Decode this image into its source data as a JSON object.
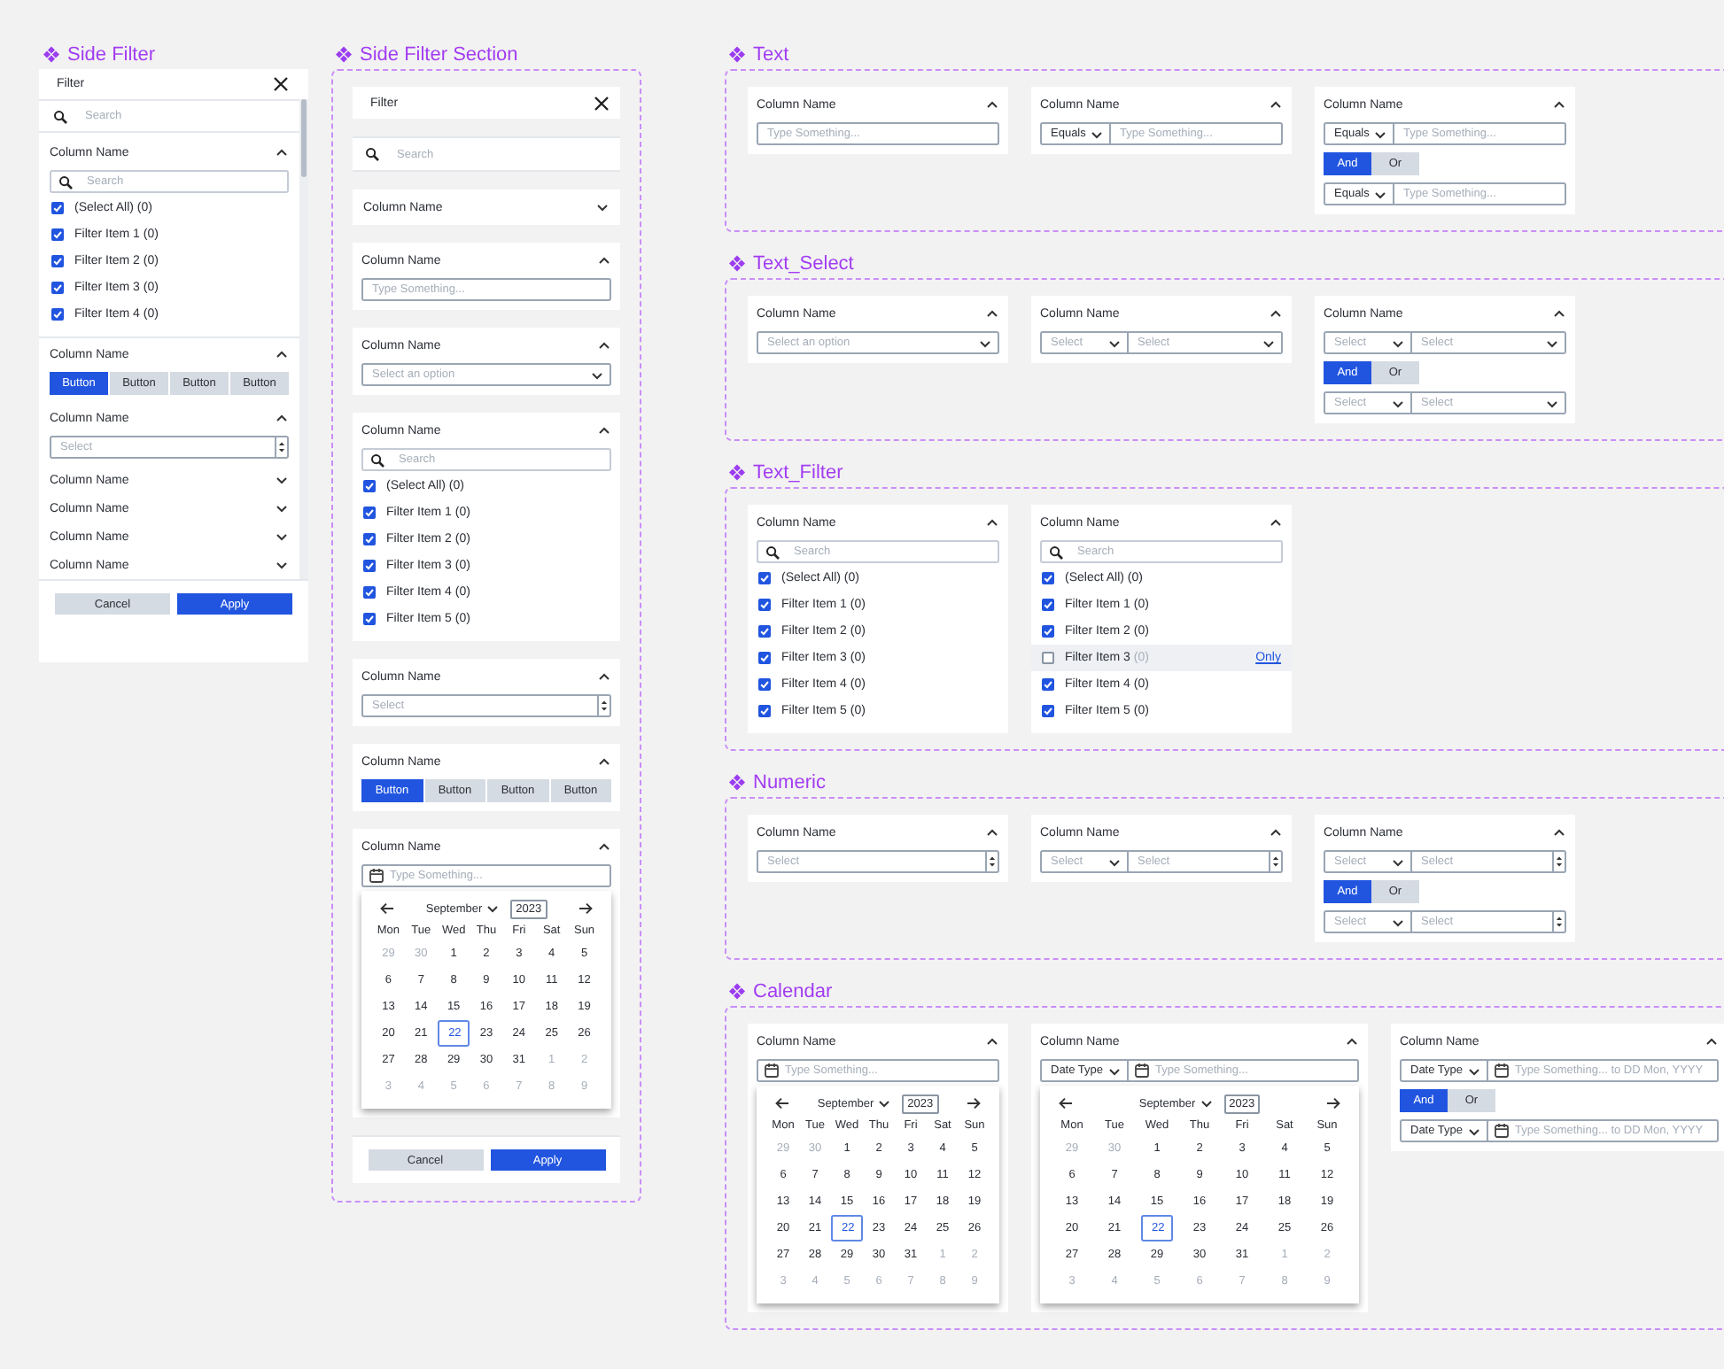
{
  "side_filter": {
    "title": "Side Filter",
    "header": "Filter",
    "search": {
      "placeholder": "Search"
    },
    "cards": [
      {
        "label": "Column Name",
        "expanded": true,
        "rows": [
          {
            "kind": "search",
            "placeholder": "Search"
          },
          {
            "kind": "checklist",
            "items": [
              {
                "label": "(Select All)",
                "count": "(0)",
                "checked": true,
                "hovered": false
              },
              {
                "label": "Filter Item 1",
                "count": "(0)",
                "checked": true,
                "hovered": false
              },
              {
                "label": "Filter Item 2",
                "count": "(0)",
                "checked": true,
                "hovered": false
              },
              {
                "label": "Filter Item 3",
                "count": "(0)",
                "checked": true,
                "hovered": false
              },
              {
                "label": "Filter Item 4",
                "count": "(0)",
                "checked": true,
                "hovered": false
              }
            ]
          }
        ]
      },
      {
        "label": "Column Name",
        "expanded": true,
        "rows": [
          {
            "kind": "segmented",
            "buttons": [
              {
                "label": "Button",
                "selected": true
              },
              {
                "label": "Button",
                "selected": false
              },
              {
                "label": "Button",
                "selected": false
              },
              {
                "label": "Button",
                "selected": false
              }
            ]
          }
        ]
      },
      {
        "label": "Column Name",
        "expanded": true,
        "rows": [
          {
            "kind": "number",
            "placeholder": "Select"
          }
        ]
      },
      {
        "label": "Column Name",
        "expanded": false
      },
      {
        "label": "Column Name",
        "expanded": false
      },
      {
        "label": "Column Name",
        "expanded": false
      },
      {
        "label": "Column Name",
        "expanded": false
      }
    ],
    "buttons": [
      {
        "label": "Cancel",
        "kind": "secondary"
      },
      {
        "label": "Apply",
        "kind": "primary"
      }
    ]
  },
  "side_filter_section": {
    "title": "Side Filter Section",
    "header": "Filter",
    "search": {
      "placeholder": "Search"
    },
    "cards": [
      {
        "label": "Column Name",
        "expanded": false
      },
      {
        "label": "Column Name",
        "expanded": true,
        "rows": [
          {
            "kind": "text",
            "placeholder": "Type Something..."
          }
        ]
      },
      {
        "label": "Column Name",
        "expanded": true,
        "rows": [
          {
            "kind": "select",
            "placeholder": "Select an option"
          }
        ]
      },
      {
        "label": "Column Name",
        "expanded": true,
        "rows": [
          {
            "kind": "search",
            "placeholder": "Search"
          },
          {
            "kind": "checklist",
            "items": [
              {
                "label": "(Select All)",
                "count": "(0)",
                "checked": true,
                "hovered": false
              },
              {
                "label": "Filter Item 1",
                "count": "(0)",
                "checked": true,
                "hovered": false
              },
              {
                "label": "Filter Item 2",
                "count": "(0)",
                "checked": true,
                "hovered": false
              },
              {
                "label": "Filter Item 3",
                "count": "(0)",
                "checked": true,
                "hovered": false
              },
              {
                "label": "Filter Item 4",
                "count": "(0)",
                "checked": true,
                "hovered": false
              },
              {
                "label": "Filter Item 5",
                "count": "(0)",
                "checked": true,
                "hovered": false
              }
            ]
          }
        ]
      },
      {
        "label": "Column Name",
        "expanded": true,
        "rows": [
          {
            "kind": "number",
            "placeholder": "Select"
          }
        ]
      },
      {
        "label": "Column Name",
        "expanded": true,
        "rows": [
          {
            "kind": "segmented",
            "buttons": [
              {
                "label": "Button",
                "selected": true
              },
              {
                "label": "Button",
                "selected": false
              },
              {
                "label": "Button",
                "selected": false
              },
              {
                "label": "Button",
                "selected": false
              }
            ]
          }
        ]
      },
      {
        "label": "Column Name",
        "expanded": true,
        "rows": [
          {
            "kind": "date",
            "placeholder": "Type Something..."
          },
          {
            "kind": "calendar",
            "month": "September",
            "year": "2023",
            "weekdays": [
              "Mon",
              "Tue",
              "Wed",
              "Thu",
              "Fri",
              "Sat",
              "Sun"
            ],
            "weeks": [
              [
                {
                  "label": "29",
                  "muted": true,
                  "selected": false
                },
                {
                  "label": "30",
                  "muted": true,
                  "selected": false
                },
                {
                  "label": "1",
                  "muted": false,
                  "selected": false
                },
                {
                  "label": "2",
                  "muted": false,
                  "selected": false
                },
                {
                  "label": "3",
                  "muted": false,
                  "selected": false
                },
                {
                  "label": "4",
                  "muted": false,
                  "selected": false
                },
                {
                  "label": "5",
                  "muted": false,
                  "selected": false
                }
              ],
              [
                {
                  "label": "6",
                  "muted": false,
                  "selected": false
                },
                {
                  "label": "7",
                  "muted": false,
                  "selected": false
                },
                {
                  "label": "8",
                  "muted": false,
                  "selected": false
                },
                {
                  "label": "9",
                  "muted": false,
                  "selected": false
                },
                {
                  "label": "10",
                  "muted": false,
                  "selected": false
                },
                {
                  "label": "11",
                  "muted": false,
                  "selected": false
                },
                {
                  "label": "12",
                  "muted": false,
                  "selected": false
                }
              ],
              [
                {
                  "label": "13",
                  "muted": false,
                  "selected": false
                },
                {
                  "label": "14",
                  "muted": false,
                  "selected": false
                },
                {
                  "label": "15",
                  "muted": false,
                  "selected": false
                },
                {
                  "label": "16",
                  "muted": false,
                  "selected": false
                },
                {
                  "label": "17",
                  "muted": false,
                  "selected": false
                },
                {
                  "label": "18",
                  "muted": false,
                  "selected": false
                },
                {
                  "label": "19",
                  "muted": false,
                  "selected": false
                }
              ],
              [
                {
                  "label": "20",
                  "muted": false,
                  "selected": false
                },
                {
                  "label": "21",
                  "muted": false,
                  "selected": false
                },
                {
                  "label": "22",
                  "muted": false,
                  "selected": true
                },
                {
                  "label": "23",
                  "muted": false,
                  "selected": false
                },
                {
                  "label": "24",
                  "muted": false,
                  "selected": false
                },
                {
                  "label": "25",
                  "muted": false,
                  "selected": false
                },
                {
                  "label": "26",
                  "muted": false,
                  "selected": false
                }
              ],
              [
                {
                  "label": "27",
                  "muted": false,
                  "selected": false
                },
                {
                  "label": "28",
                  "muted": false,
                  "selected": false
                },
                {
                  "label": "29",
                  "muted": false,
                  "selected": false
                },
                {
                  "label": "30",
                  "muted": false,
                  "selected": false
                },
                {
                  "label": "31",
                  "muted": false,
                  "selected": false
                },
                {
                  "label": "1",
                  "muted": true,
                  "selected": false
                },
                {
                  "label": "2",
                  "muted": true,
                  "selected": false
                }
              ],
              [
                {
                  "label": "3",
                  "muted": true,
                  "selected": false
                },
                {
                  "label": "4",
                  "muted": true,
                  "selected": false
                },
                {
                  "label": "5",
                  "muted": true,
                  "selected": false
                },
                {
                  "label": "6",
                  "muted": true,
                  "selected": false
                },
                {
                  "label": "7",
                  "muted": true,
                  "selected": false
                },
                {
                  "label": "8",
                  "muted": true,
                  "selected": false
                },
                {
                  "label": "9",
                  "muted": true,
                  "selected": false
                }
              ]
            ]
          }
        ]
      }
    ],
    "buttons": [
      {
        "label": "Cancel",
        "kind": "secondary"
      },
      {
        "label": "Apply",
        "kind": "primary"
      }
    ]
  },
  "sections": [
    {
      "title": "Text",
      "cards": [
        {
          "label": "Column Name",
          "expanded": true,
          "rows": [
            {
              "kind": "text",
              "placeholder": "Type Something..."
            }
          ]
        },
        {
          "label": "Column Name",
          "expanded": true,
          "rows": [
            {
              "kind": "op_text",
              "operator": "Equals",
              "placeholder": "Type Something..."
            }
          ]
        },
        {
          "label": "Column Name",
          "expanded": true,
          "rows": [
            {
              "kind": "op_text",
              "operator": "Equals",
              "placeholder": "Type Something..."
            },
            {
              "kind": "logic",
              "options": [
                {
                  "label": "And",
                  "selected": true
                },
                {
                  "label": "Or",
                  "selected": false
                }
              ]
            },
            {
              "kind": "op_text",
              "operator": "Equals",
              "placeholder": "Type Something..."
            }
          ]
        }
      ]
    },
    {
      "title": "Text_Select",
      "cards": [
        {
          "label": "Column Name",
          "expanded": true,
          "rows": [
            {
              "kind": "select",
              "placeholder": "Select an option"
            }
          ]
        },
        {
          "label": "Column Name",
          "expanded": true,
          "rows": [
            {
              "kind": "select_pair",
              "placeholder": "Select",
              "second_placeholder": "Select"
            }
          ]
        },
        {
          "label": "Column Name",
          "expanded": true,
          "rows": [
            {
              "kind": "select_pair",
              "placeholder": "Select",
              "second_placeholder": "Select"
            },
            {
              "kind": "logic",
              "options": [
                {
                  "label": "And",
                  "selected": true
                },
                {
                  "label": "Or",
                  "selected": false
                }
              ]
            },
            {
              "kind": "select_pair",
              "placeholder": "Select",
              "second_placeholder": "Select"
            }
          ]
        }
      ]
    },
    {
      "title": "Text_Filter",
      "cards": [
        {
          "label": "Column Name",
          "expanded": true,
          "rows": [
            {
              "kind": "search",
              "placeholder": "Search"
            },
            {
              "kind": "checklist",
              "items": [
                {
                  "label": "(Select All)",
                  "count": "(0)",
                  "checked": true,
                  "hovered": false
                },
                {
                  "label": "Filter Item 1",
                  "count": "(0)",
                  "checked": true,
                  "hovered": false
                },
                {
                  "label": "Filter Item 2",
                  "count": "(0)",
                  "checked": true,
                  "hovered": false
                },
                {
                  "label": "Filter Item 3",
                  "count": "(0)",
                  "checked": true,
                  "hovered": false
                },
                {
                  "label": "Filter Item 4",
                  "count": "(0)",
                  "checked": true,
                  "hovered": false
                },
                {
                  "label": "Filter Item 5",
                  "count": "(0)",
                  "checked": true,
                  "hovered": false
                }
              ]
            }
          ]
        },
        {
          "label": "Column Name",
          "expanded": true,
          "rows": [
            {
              "kind": "search",
              "placeholder": "Search"
            },
            {
              "kind": "checklist",
              "items": [
                {
                  "label": "(Select All)",
                  "count": "(0)",
                  "checked": true,
                  "hovered": false
                },
                {
                  "label": "Filter Item 1",
                  "count": "(0)",
                  "checked": true,
                  "hovered": false
                },
                {
                  "label": "Filter Item 2",
                  "count": "(0)",
                  "checked": true,
                  "hovered": false
                },
                {
                  "label": "Filter Item 3",
                  "count": "(0)",
                  "checked": false,
                  "hovered": true,
                  "action": "Only"
                },
                {
                  "label": "Filter Item 4",
                  "count": "(0)",
                  "checked": true,
                  "hovered": false
                },
                {
                  "label": "Filter Item 5",
                  "count": "(0)",
                  "checked": true,
                  "hovered": false
                }
              ]
            }
          ]
        }
      ]
    },
    {
      "title": "Numeric",
      "cards": [
        {
          "label": "Column Name",
          "expanded": true,
          "rows": [
            {
              "kind": "number",
              "placeholder": "Select"
            }
          ]
        },
        {
          "label": "Column Name",
          "expanded": true,
          "rows": [
            {
              "kind": "select_number",
              "placeholder": "Select",
              "second_placeholder": "Select"
            }
          ]
        },
        {
          "label": "Column Name",
          "expanded": true,
          "rows": [
            {
              "kind": "select_number",
              "placeholder": "Select",
              "second_placeholder": "Select"
            },
            {
              "kind": "logic",
              "options": [
                {
                  "label": "And",
                  "selected": true
                },
                {
                  "label": "Or",
                  "selected": false
                }
              ]
            },
            {
              "kind": "select_number",
              "placeholder": "Select",
              "second_placeholder": "Select"
            }
          ]
        }
      ]
    },
    {
      "title": "Calendar",
      "cards": [
        {
          "label": "Column Name",
          "expanded": true,
          "rows": [
            {
              "kind": "date",
              "placeholder": "Type Something..."
            },
            {
              "kind": "calendar",
              "month": "September",
              "year": "2023",
              "weekdays": [
                "Mon",
                "Tue",
                "Wed",
                "Thu",
                "Fri",
                "Sat",
                "Sun"
              ],
              "weeks": [
                [
                  {
                    "label": "29",
                    "muted": true,
                    "selected": false
                  },
                  {
                    "label": "30",
                    "muted": true,
                    "selected": false
                  },
                  {
                    "label": "1",
                    "muted": false,
                    "selected": false
                  },
                  {
                    "label": "2",
                    "muted": false,
                    "selected": false
                  },
                  {
                    "label": "3",
                    "muted": false,
                    "selected": false
                  },
                  {
                    "label": "4",
                    "muted": false,
                    "selected": false
                  },
                  {
                    "label": "5",
                    "muted": false,
                    "selected": false
                  }
                ],
                [
                  {
                    "label": "6",
                    "muted": false,
                    "selected": false
                  },
                  {
                    "label": "7",
                    "muted": false,
                    "selected": false
                  },
                  {
                    "label": "8",
                    "muted": false,
                    "selected": false
                  },
                  {
                    "label": "9",
                    "muted": false,
                    "selected": false
                  },
                  {
                    "label": "10",
                    "muted": false,
                    "selected": false
                  },
                  {
                    "label": "11",
                    "muted": false,
                    "selected": false
                  },
                  {
                    "label": "12",
                    "muted": false,
                    "selected": false
                  }
                ],
                [
                  {
                    "label": "13",
                    "muted": false,
                    "selected": false
                  },
                  {
                    "label": "14",
                    "muted": false,
                    "selected": false
                  },
                  {
                    "label": "15",
                    "muted": false,
                    "selected": false
                  },
                  {
                    "label": "16",
                    "muted": false,
                    "selected": false
                  },
                  {
                    "label": "17",
                    "muted": false,
                    "selected": false
                  },
                  {
                    "label": "18",
                    "muted": false,
                    "selected": false
                  },
                  {
                    "label": "19",
                    "muted": false,
                    "selected": false
                  }
                ],
                [
                  {
                    "label": "20",
                    "muted": false,
                    "selected": false
                  },
                  {
                    "label": "21",
                    "muted": false,
                    "selected": false
                  },
                  {
                    "label": "22",
                    "muted": false,
                    "selected": true
                  },
                  {
                    "label": "23",
                    "muted": false,
                    "selected": false
                  },
                  {
                    "label": "24",
                    "muted": false,
                    "selected": false
                  },
                  {
                    "label": "25",
                    "muted": false,
                    "selected": false
                  },
                  {
                    "label": "26",
                    "muted": false,
                    "selected": false
                  }
                ],
                [
                  {
                    "label": "27",
                    "muted": false,
                    "selected": false
                  },
                  {
                    "label": "28",
                    "muted": false,
                    "selected": false
                  },
                  {
                    "label": "29",
                    "muted": false,
                    "selected": false
                  },
                  {
                    "label": "30",
                    "muted": false,
                    "selected": false
                  },
                  {
                    "label": "31",
                    "muted": false,
                    "selected": false
                  },
                  {
                    "label": "1",
                    "muted": true,
                    "selected": false
                  },
                  {
                    "label": "2",
                    "muted": true,
                    "selected": false
                  }
                ],
                [
                  {
                    "label": "3",
                    "muted": true,
                    "selected": false
                  },
                  {
                    "label": "4",
                    "muted": true,
                    "selected": false
                  },
                  {
                    "label": "5",
                    "muted": true,
                    "selected": false
                  },
                  {
                    "label": "6",
                    "muted": true,
                    "selected": false
                  },
                  {
                    "label": "7",
                    "muted": true,
                    "selected": false
                  },
                  {
                    "label": "8",
                    "muted": true,
                    "selected": false
                  },
                  {
                    "label": "9",
                    "muted": true,
                    "selected": false
                  }
                ]
              ]
            }
          ]
        },
        {
          "label": "Column Name",
          "expanded": true,
          "rows": [
            {
              "kind": "op_date",
              "operator": "Date Type",
              "placeholder": "Type Something..."
            },
            {
              "kind": "calendar",
              "month": "September",
              "year": "2023",
              "weekdays": [
                "Mon",
                "Tue",
                "Wed",
                "Thu",
                "Fri",
                "Sat",
                "Sun"
              ],
              "weeks": [
                [
                  {
                    "label": "29",
                    "muted": true,
                    "selected": false
                  },
                  {
                    "label": "30",
                    "muted": true,
                    "selected": false
                  },
                  {
                    "label": "1",
                    "muted": false,
                    "selected": false
                  },
                  {
                    "label": "2",
                    "muted": false,
                    "selected": false
                  },
                  {
                    "label": "3",
                    "muted": false,
                    "selected": false
                  },
                  {
                    "label": "4",
                    "muted": false,
                    "selected": false
                  },
                  {
                    "label": "5",
                    "muted": false,
                    "selected": false
                  }
                ],
                [
                  {
                    "label": "6",
                    "muted": false,
                    "selected": false
                  },
                  {
                    "label": "7",
                    "muted": false,
                    "selected": false
                  },
                  {
                    "label": "8",
                    "muted": false,
                    "selected": false
                  },
                  {
                    "label": "9",
                    "muted": false,
                    "selected": false
                  },
                  {
                    "label": "10",
                    "muted": false,
                    "selected": false
                  },
                  {
                    "label": "11",
                    "muted": false,
                    "selected": false
                  },
                  {
                    "label": "12",
                    "muted": false,
                    "selected": false
                  }
                ],
                [
                  {
                    "label": "13",
                    "muted": false,
                    "selected": false
                  },
                  {
                    "label": "14",
                    "muted": false,
                    "selected": false
                  },
                  {
                    "label": "15",
                    "muted": false,
                    "selected": false
                  },
                  {
                    "label": "16",
                    "muted": false,
                    "selected": false
                  },
                  {
                    "label": "17",
                    "muted": false,
                    "selected": false
                  },
                  {
                    "label": "18",
                    "muted": false,
                    "selected": false
                  },
                  {
                    "label": "19",
                    "muted": false,
                    "selected": false
                  }
                ],
                [
                  {
                    "label": "20",
                    "muted": false,
                    "selected": false
                  },
                  {
                    "label": "21",
                    "muted": false,
                    "selected": false
                  },
                  {
                    "label": "22",
                    "muted": false,
                    "selected": true
                  },
                  {
                    "label": "23",
                    "muted": false,
                    "selected": false
                  },
                  {
                    "label": "24",
                    "muted": false,
                    "selected": false
                  },
                  {
                    "label": "25",
                    "muted": false,
                    "selected": false
                  },
                  {
                    "label": "26",
                    "muted": false,
                    "selected": false
                  }
                ],
                [
                  {
                    "label": "27",
                    "muted": false,
                    "selected": false
                  },
                  {
                    "label": "28",
                    "muted": false,
                    "selected": false
                  },
                  {
                    "label": "29",
                    "muted": false,
                    "selected": false
                  },
                  {
                    "label": "30",
                    "muted": false,
                    "selected": false
                  },
                  {
                    "label": "31",
                    "muted": false,
                    "selected": false
                  },
                  {
                    "label": "1",
                    "muted": true,
                    "selected": false
                  },
                  {
                    "label": "2",
                    "muted": true,
                    "selected": false
                  }
                ],
                [
                  {
                    "label": "3",
                    "muted": true,
                    "selected": false
                  },
                  {
                    "label": "4",
                    "muted": true,
                    "selected": false
                  },
                  {
                    "label": "5",
                    "muted": true,
                    "selected": false
                  },
                  {
                    "label": "6",
                    "muted": true,
                    "selected": false
                  },
                  {
                    "label": "7",
                    "muted": true,
                    "selected": false
                  },
                  {
                    "label": "8",
                    "muted": true,
                    "selected": false
                  },
                  {
                    "label": "9",
                    "muted": true,
                    "selected": false
                  }
                ]
              ]
            }
          ]
        },
        {
          "label": "Column Name",
          "expanded": true,
          "rows": [
            {
              "kind": "op_date",
              "operator": "Date Type",
              "placeholder": "Type Something... to DD Mon, YYYY"
            },
            {
              "kind": "logic",
              "options": [
                {
                  "label": "And",
                  "selected": true
                },
                {
                  "label": "Or",
                  "selected": false
                }
              ]
            },
            {
              "kind": "op_date",
              "operator": "Date Type",
              "placeholder": "Type Something... to DD Mon, YYYY"
            }
          ]
        }
      ]
    }
  ]
}
